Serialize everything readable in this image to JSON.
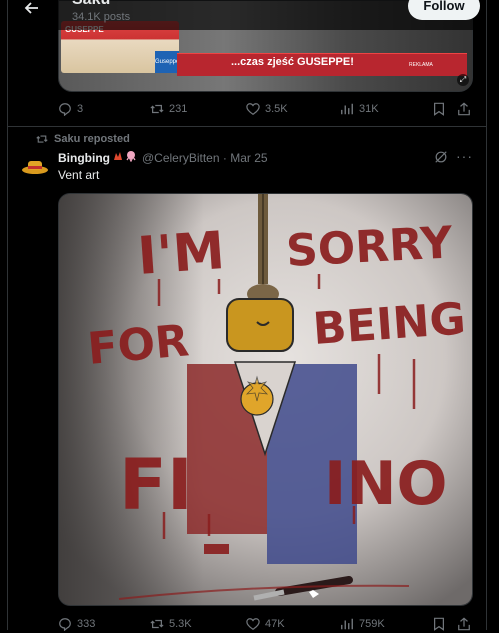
{
  "header": {
    "name": "Saku",
    "posts": "34.1K posts",
    "follow_label": "Follow"
  },
  "top_post": {
    "media": {
      "banner_text": "...czas zjeść GUSEPPE!",
      "reklama": "REKLAMA",
      "logo": "GUSEPPE",
      "badge": "Guseppe"
    },
    "actions": {
      "replies": "3",
      "reposts": "231",
      "likes": "3.5K",
      "views": "31K"
    }
  },
  "repost": {
    "label": "Saku reposted",
    "author_name": "Bingbing",
    "handle_date": "@CeleryBitten · Mar 25",
    "text": "Vent art",
    "art_text": {
      "line1a": "I'M",
      "line1b": "SORRY",
      "line2a": "FOR",
      "line2b": "BEING",
      "line3a": "FI",
      "line3b": "INO"
    },
    "actions": {
      "replies": "333",
      "reposts": "5.3K",
      "likes": "47K",
      "views": "759K"
    }
  },
  "colors": {
    "background": "#000000",
    "border": "#2f3336",
    "muted": "#71767b",
    "text": "#e7e9ea",
    "blood": "#8a1e1e"
  }
}
